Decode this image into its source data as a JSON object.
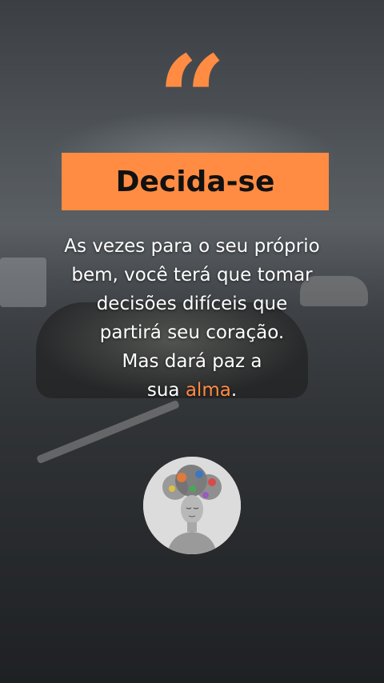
{
  "quote_icon": "quote-icon",
  "title": "Decida-se",
  "quote": {
    "line1": "As vezes para o seu próprio",
    "line2": "bem, você terá que tomar",
    "line3": "decisões difíceis que",
    "line4": "partirá seu coração.",
    "line5": "Mas dará paz a",
    "line6_prefix": "sua ",
    "line6_accent": "alma",
    "line6_suffix": "."
  },
  "avatar_icon": "woman-portrait-avatar",
  "colors": {
    "accent": "#ff8c42",
    "text": "#ffffff",
    "title_text": "#111111"
  }
}
